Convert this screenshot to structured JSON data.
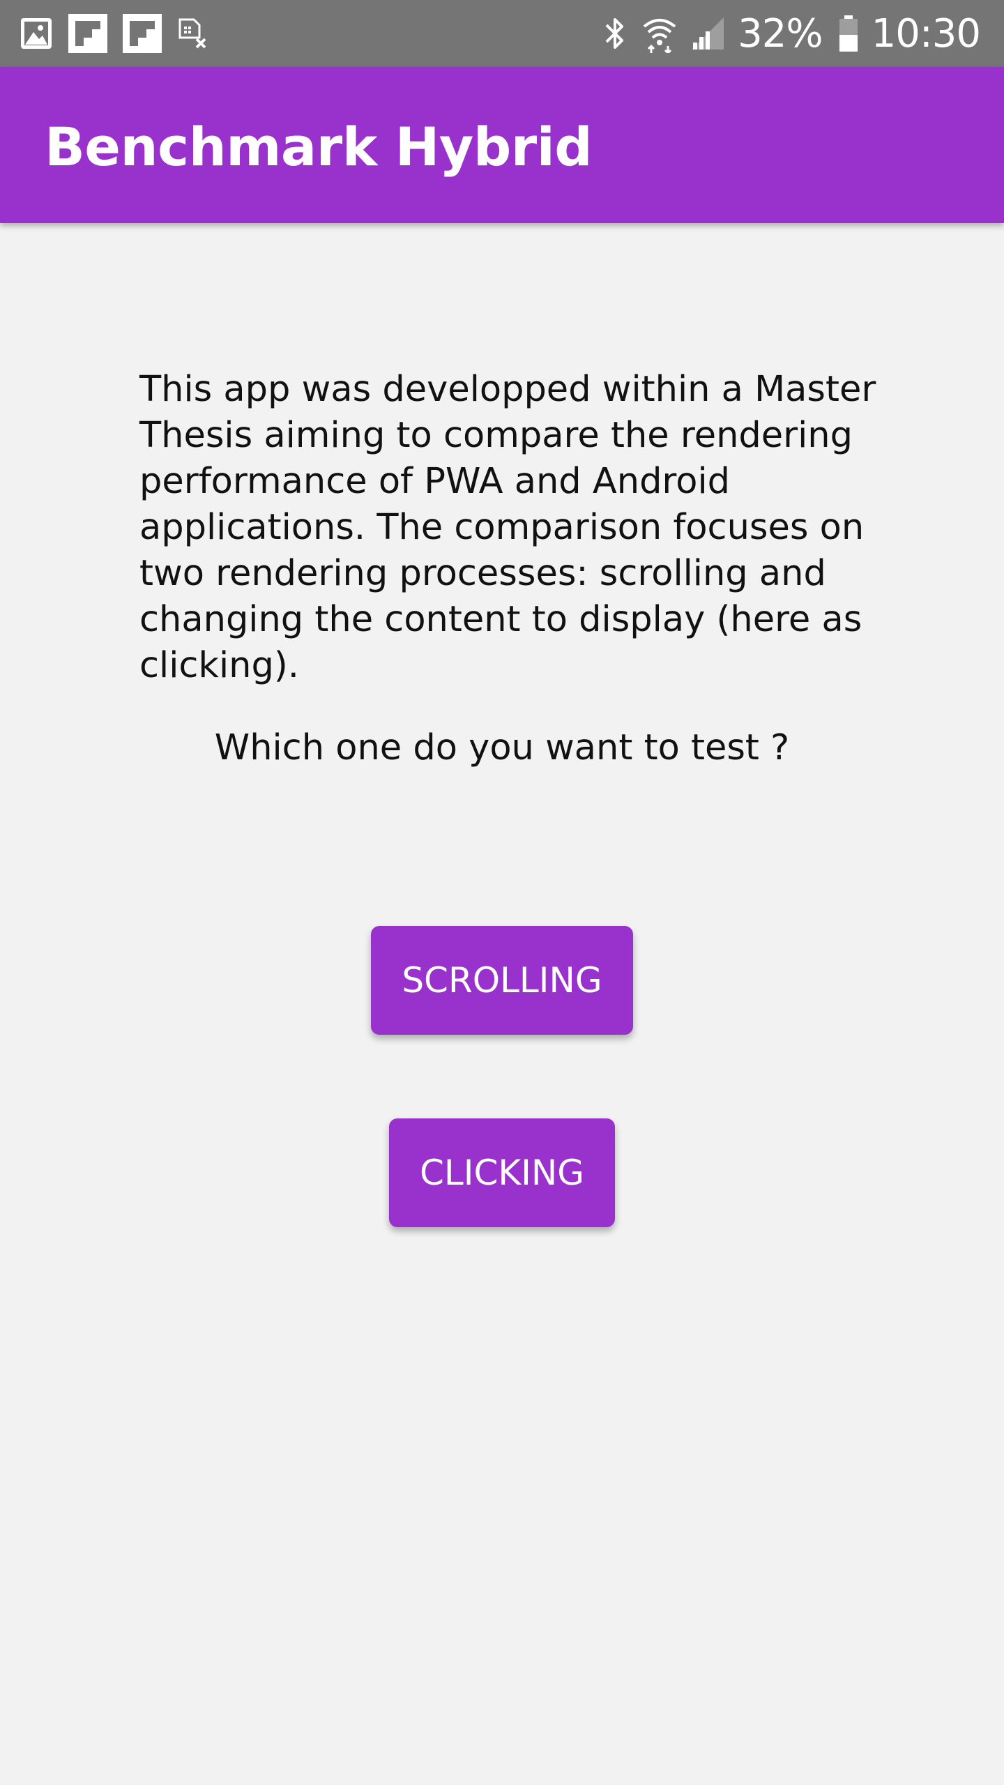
{
  "status_bar": {
    "left_icons": [
      "gallery-icon",
      "flipboard-icon",
      "flipboard-icon",
      "sim-card-x-icon"
    ],
    "right_icons": [
      "bluetooth-icon",
      "wifi-icon",
      "signal-icon",
      "battery-icon"
    ],
    "battery_percent": "32%",
    "time": "10:30"
  },
  "app_bar": {
    "title": "Benchmark Hybrid",
    "color": "#9932cc"
  },
  "main": {
    "description": "This app was developped within a Master Thesis aiming to compare the rendering performance of PWA and Android applications. The comparison focuses on two rendering processes: scrolling and changing the content to display (here as clicking).",
    "question": "Which one do you want to test ?",
    "buttons": {
      "scrolling_label": "SCROLLING",
      "clicking_label": "CLICKING"
    }
  },
  "colors": {
    "accent": "#9932cc",
    "background": "#f2f2f2",
    "status_bar": "#757575"
  }
}
